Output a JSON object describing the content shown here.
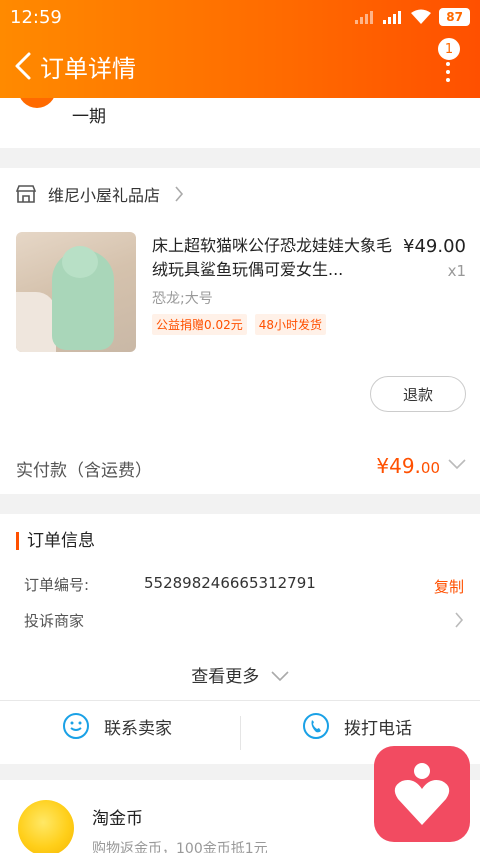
{
  "status_bar": {
    "time": "12:59",
    "battery": "87"
  },
  "nav": {
    "title": "订单详情",
    "badge": "1"
  },
  "address": {
    "tail_text": "一期"
  },
  "order": {
    "shop_name": "维尼小屋礼品店",
    "product_title": "床上超软猫咪公仔恐龙娃娃大象毛绒玩具鲨鱼玩偶可爱女生...",
    "price": "¥49.00",
    "quantity": "x1",
    "spec": "恐龙;大号",
    "tags": [
      "公益捐赠0.02元",
      "48小时发货"
    ],
    "refund_label": "退款",
    "paid_label": "实付款（含运费）",
    "paid_amount_main": "¥49.",
    "paid_amount_decimal": "00"
  },
  "order_info": {
    "title": "订单信息",
    "order_no_label": "订单编号:",
    "order_no": "552898246665312791",
    "copy_label": "复制",
    "complain_label": "投诉商家",
    "more_label": "查看更多",
    "contact_seller": "联系卖家",
    "call_phone": "拨打电话"
  },
  "coins": {
    "title": "淘金币",
    "subtitle": "购物返金币，100金币抵1元"
  },
  "colors": {
    "accent": "#ff5000",
    "header": "#ff6a00",
    "float_button": "#f24b61"
  }
}
